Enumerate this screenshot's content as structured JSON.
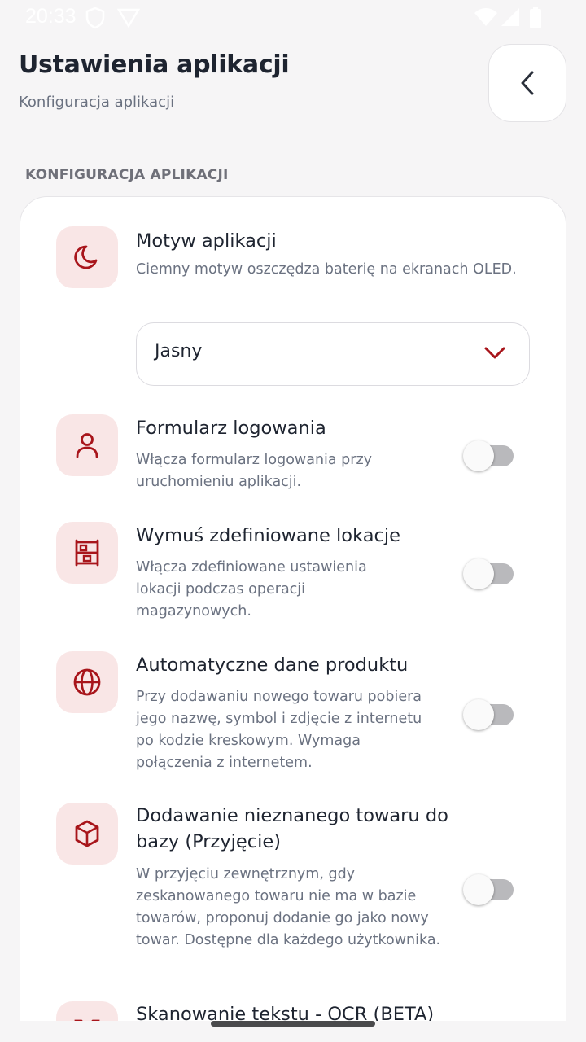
{
  "status_bar": {
    "time": "20:33"
  },
  "header": {
    "title": "Ustawienia aplikacji",
    "subtitle": "Konfiguracja aplikacji"
  },
  "section": {
    "label": "KONFIGURACJA APLIKACJI"
  },
  "settings": [
    {
      "icon": "moon-icon",
      "title": "Motyw aplikacji",
      "description": "Ciemny motyw oszczędza baterię na ekranach OLED.",
      "control": "select",
      "selected_value": "Jasny"
    },
    {
      "icon": "user-icon",
      "title": "Formularz logowania",
      "description": "Włącza formularz logowania przy uruchomieniu aplikacji.",
      "control": "toggle",
      "enabled": false
    },
    {
      "icon": "warehouse-shelf-icon",
      "title": "Wymuś zdefiniowane lokacje",
      "description": "Włącza zdefiniowane ustawienia lokacji podczas operacji magazynowych.",
      "control": "toggle",
      "enabled": false
    },
    {
      "icon": "globe-icon",
      "title": "Automatyczne dane produktu",
      "description": "Przy dodawaniu nowego towaru pobiera jego nazwę, symbol i zdjęcie z internetu po kodzie kreskowym. Wymaga połączenia z internetem.",
      "control": "toggle",
      "enabled": false
    },
    {
      "icon": "cube-icon",
      "title": "Dodawanie nieznanego towaru do bazy (Przyjęcie)",
      "description": "W przyjęciu zewnętrznym, gdy zeskanowanego towaru nie ma w bazie towarów, proponuj dodanie go jako nowy towar. Dostępne dla każdego użytkownika.",
      "control": "toggle",
      "enabled": false
    },
    {
      "icon": "scan-text-icon",
      "title": "Skanowanie tekstu - OCR (BETA)"
    }
  ],
  "colors": {
    "accent": "#a8151b",
    "icon_tile_bg": "#f9e6e6",
    "background": "#f6f5f6"
  }
}
